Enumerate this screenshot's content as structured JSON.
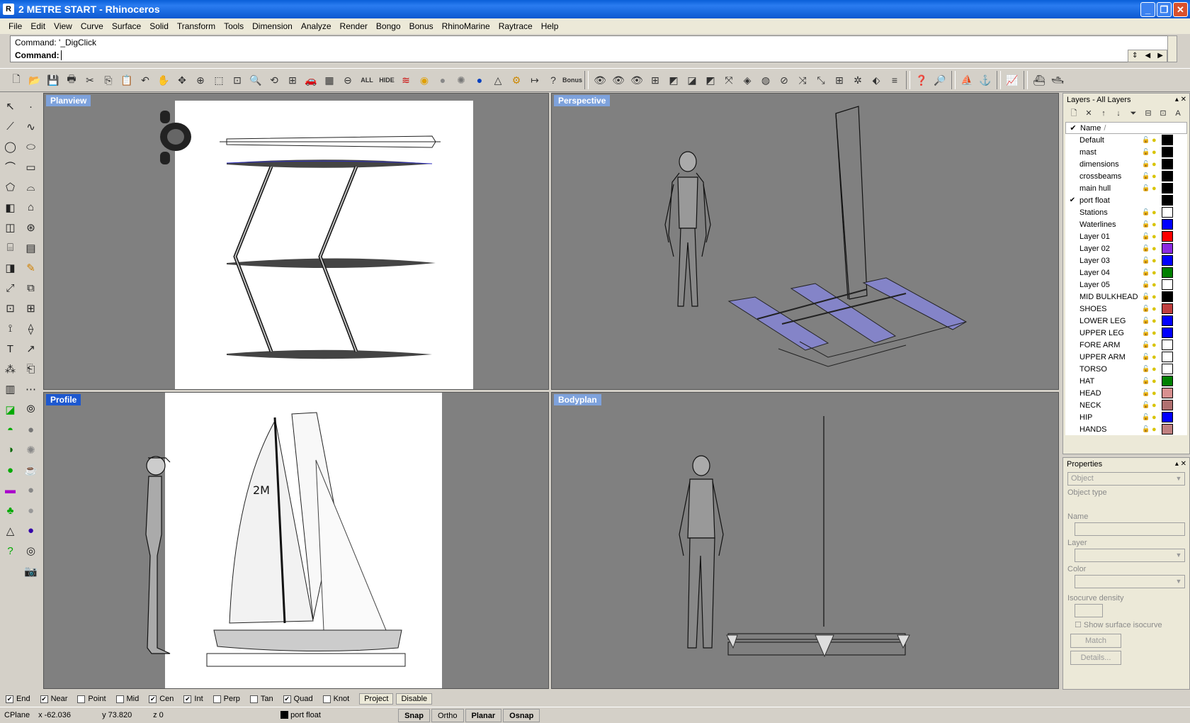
{
  "window": {
    "title": "2 METRE START - Rhinoceros",
    "min": "_",
    "max": "❐",
    "close": "✕",
    "app_icon": "R"
  },
  "menu": [
    "File",
    "Edit",
    "View",
    "Curve",
    "Surface",
    "Solid",
    "Transform",
    "Tools",
    "Dimension",
    "Analyze",
    "Render",
    "Bongo",
    "Bonus",
    "RhinoMarine",
    "Raytrace",
    "Help"
  ],
  "command": {
    "history": "Command: '_DigClick",
    "prompt": "Command:",
    "value": ""
  },
  "toolbar": {
    "all_label": "ALL",
    "hide_label": "HIDE",
    "bonus_label": "Bonus"
  },
  "viewports": {
    "plan": {
      "title": "Planview"
    },
    "perspective": {
      "title": "Perspective"
    },
    "profile": {
      "title": "Profile",
      "sail_number": "2M"
    },
    "bodyplan": {
      "title": "Bodyplan"
    }
  },
  "layers": {
    "title": "Layers - All Layers",
    "column_name": "Name",
    "sort_indicator": "/",
    "rows": [
      {
        "name": "Default",
        "color": "#000000",
        "current": false
      },
      {
        "name": "mast",
        "color": "#000000",
        "current": false
      },
      {
        "name": "dimensions",
        "color": "#000000",
        "current": false
      },
      {
        "name": "crossbeams",
        "color": "#000000",
        "current": false
      },
      {
        "name": "main hull",
        "color": "#000000",
        "current": false
      },
      {
        "name": "port float",
        "color": "#000000",
        "current": true
      },
      {
        "name": "Stations",
        "color": "#ffffff",
        "current": false
      },
      {
        "name": "Waterlines",
        "color": "#0000ff",
        "current": false
      },
      {
        "name": "Layer 01",
        "color": "#ff0000",
        "current": false
      },
      {
        "name": "Layer 02",
        "color": "#8a2be2",
        "current": false
      },
      {
        "name": "Layer 03",
        "color": "#0000ff",
        "current": false
      },
      {
        "name": "Layer 04",
        "color": "#008000",
        "current": false
      },
      {
        "name": "Layer 05",
        "color": "#ffffff",
        "current": false
      },
      {
        "name": "MID BULKHEAD",
        "color": "#000000",
        "current": false
      },
      {
        "name": "SHOES",
        "color": "#c04040",
        "current": false
      },
      {
        "name": "LOWER LEG",
        "color": "#0000ff",
        "current": false
      },
      {
        "name": "UPPER LEG",
        "color": "#0000ff",
        "current": false
      },
      {
        "name": "FORE ARM",
        "color": "#ffffff",
        "current": false
      },
      {
        "name": "UPPER ARM",
        "color": "#ffffff",
        "current": false
      },
      {
        "name": "TORSO",
        "color": "#ffffff",
        "current": false
      },
      {
        "name": "HAT",
        "color": "#008000",
        "current": false
      },
      {
        "name": "HEAD",
        "color": "#d89090",
        "current": false
      },
      {
        "name": "NECK",
        "color": "#b07070",
        "current": false
      },
      {
        "name": "HIP",
        "color": "#0000ff",
        "current": false
      },
      {
        "name": "HANDS",
        "color": "#c08080",
        "current": false
      }
    ]
  },
  "properties": {
    "title": "Properties",
    "object_select": "Object",
    "object_type_label": "Object type",
    "name_label": "Name",
    "layer_label": "Layer",
    "color_label": "Color",
    "isocurve_label": "Isocurve density",
    "show_isocurve_label": "Show surface isocurve",
    "match_label": "Match",
    "details_label": "Details..."
  },
  "osnaps": [
    {
      "label": "End",
      "checked": true
    },
    {
      "label": "Near",
      "checked": true
    },
    {
      "label": "Point",
      "checked": false
    },
    {
      "label": "Mid",
      "checked": false
    },
    {
      "label": "Cen",
      "checked": true
    },
    {
      "label": "Int",
      "checked": true
    },
    {
      "label": "Perp",
      "checked": false
    },
    {
      "label": "Tan",
      "checked": false
    },
    {
      "label": "Quad",
      "checked": true
    },
    {
      "label": "Knot",
      "checked": false
    }
  ],
  "osnap_buttons": {
    "project": "Project",
    "disable": "Disable"
  },
  "status": {
    "cplane": "CPlane",
    "x": "x -62.036",
    "y": "y 73.820",
    "z": "z 0",
    "layer": "port float",
    "snap": "Snap",
    "ortho": "Ortho",
    "planar": "Planar",
    "osnap": "Osnap"
  },
  "accent_color": "#1d58d0"
}
